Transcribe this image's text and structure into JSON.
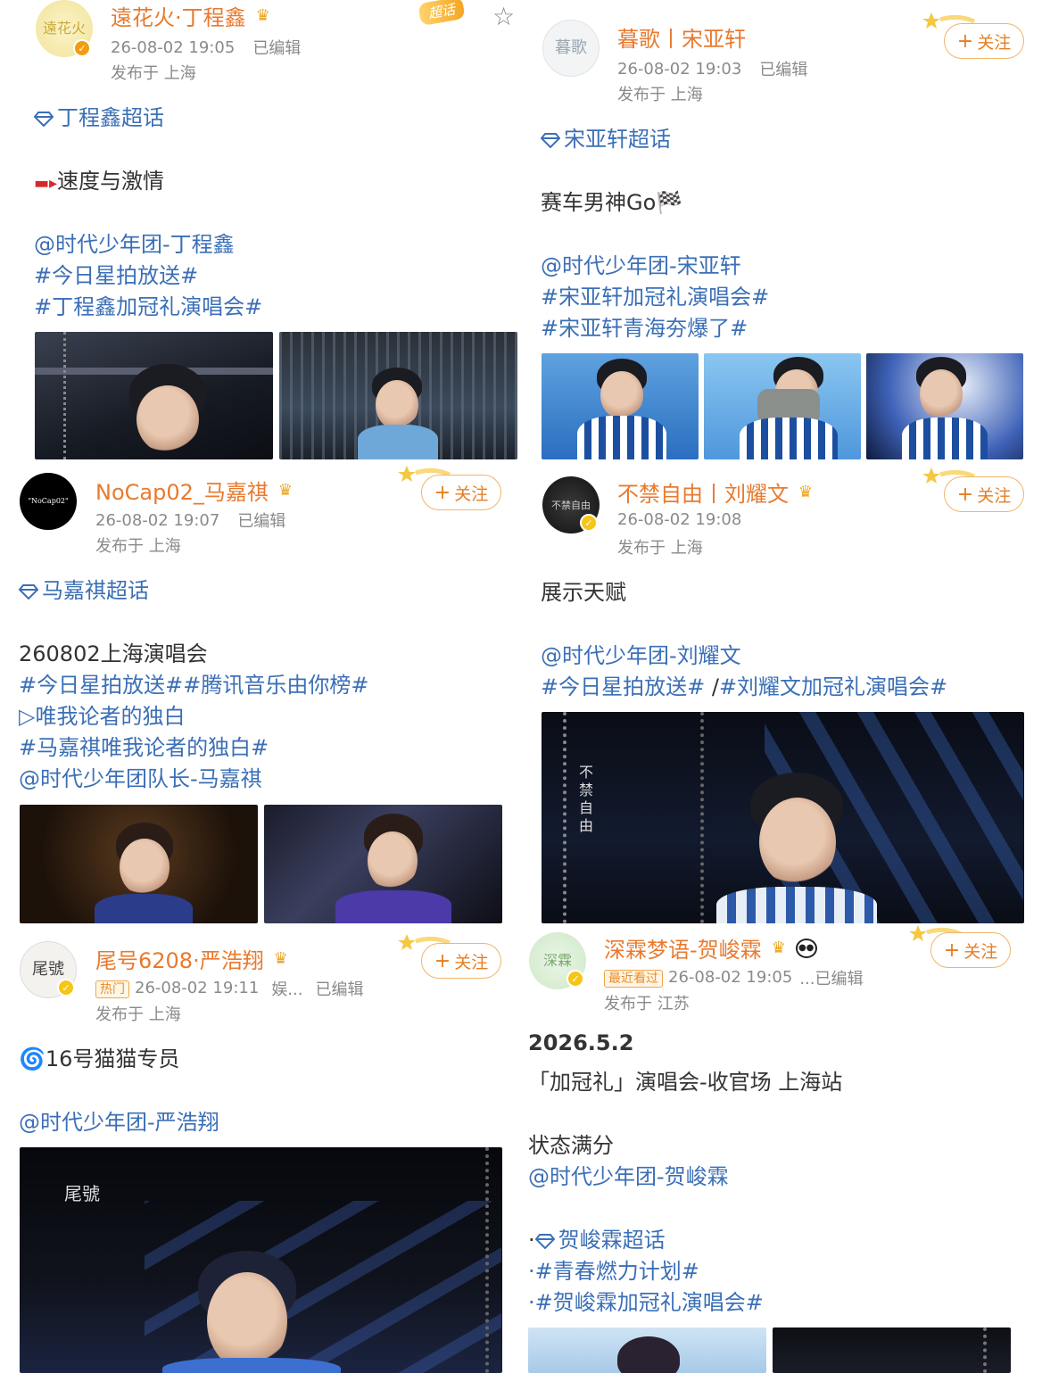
{
  "posts": [
    {
      "avatar_text": "遠花火",
      "name": "遠花火·丁程鑫",
      "time": "26-08-02 19:05",
      "edited": "已编辑",
      "location": "发布于 上海",
      "ribbon": "超话",
      "lines": [
        "丁程鑫超话",
        "速度与激情",
        "@时代少年团-丁程鑫",
        "#今日星拍放送#",
        "#丁程鑫加冠礼演唱会#"
      ]
    },
    {
      "avatar_text": "暮歌",
      "name": "暮歌丨宋亚轩",
      "time": "26-08-02 19:03",
      "edited": "已编辑",
      "location": "发布于 上海",
      "follow": "关注",
      "lines": [
        "宋亚轩超话",
        "赛车男神Go🏁",
        "@时代少年团-宋亚轩",
        "#宋亚轩加冠礼演唱会#",
        "#宋亚轩青海夯爆了#"
      ]
    },
    {
      "avatar_text": "\"NoCap02\"",
      "name": "NoCap02_马嘉祺",
      "time": "26-08-02 19:07",
      "edited": "已编辑",
      "location": "发布于 上海",
      "follow": "关注",
      "lines": [
        "马嘉祺超话",
        "260802上海演唱会",
        "#今日星拍放送##腾讯音乐由你榜#",
        "▷唯我论者的独白",
        "#马嘉祺唯我论者的独白#",
        "@时代少年团队长-马嘉祺"
      ]
    },
    {
      "avatar_text": "不禁自由",
      "name": "不禁自由丨刘耀文",
      "time": "26-08-02 19:08",
      "location": "发布于 上海",
      "follow": "关注",
      "image_text": "不禁自由",
      "lines": [
        "展示天赋",
        "@时代少年团-刘耀文",
        "#今日星拍放送#",
        " /",
        "#刘耀文加冠礼演唱会#"
      ]
    },
    {
      "avatar_text": "尾號",
      "name": "尾号6208·严浩翔",
      "badge": "热门",
      "time": "26-08-02 19:11",
      "extra": "娱...",
      "edited": "已编辑",
      "location": "发布于 上海",
      "follow": "关注",
      "image_text": "尾號",
      "lines": [
        "🌀16号猫猫专员",
        "@时代少年团-严浩翔"
      ]
    },
    {
      "avatar_text": "深霖",
      "name": "深霖梦语-贺峻霖",
      "badge": "最近看过",
      "time": "26-08-02 19:05",
      "edited": "...已编辑",
      "location": "发布于 江苏",
      "follow": "关注",
      "lines": [
        "2026.5.2",
        "「加冠礼」演唱会-收官场 上海站",
        "状态满分",
        "@时代少年团-贺峻霖",
        "·",
        "贺峻霖超话",
        "·#青春燃力计划#",
        "·#贺峻霖加冠礼演唱会#"
      ]
    }
  ],
  "colors": {
    "name": "#e87a2e",
    "link": "#3b6fb6",
    "meta": "#8a8a8a"
  }
}
